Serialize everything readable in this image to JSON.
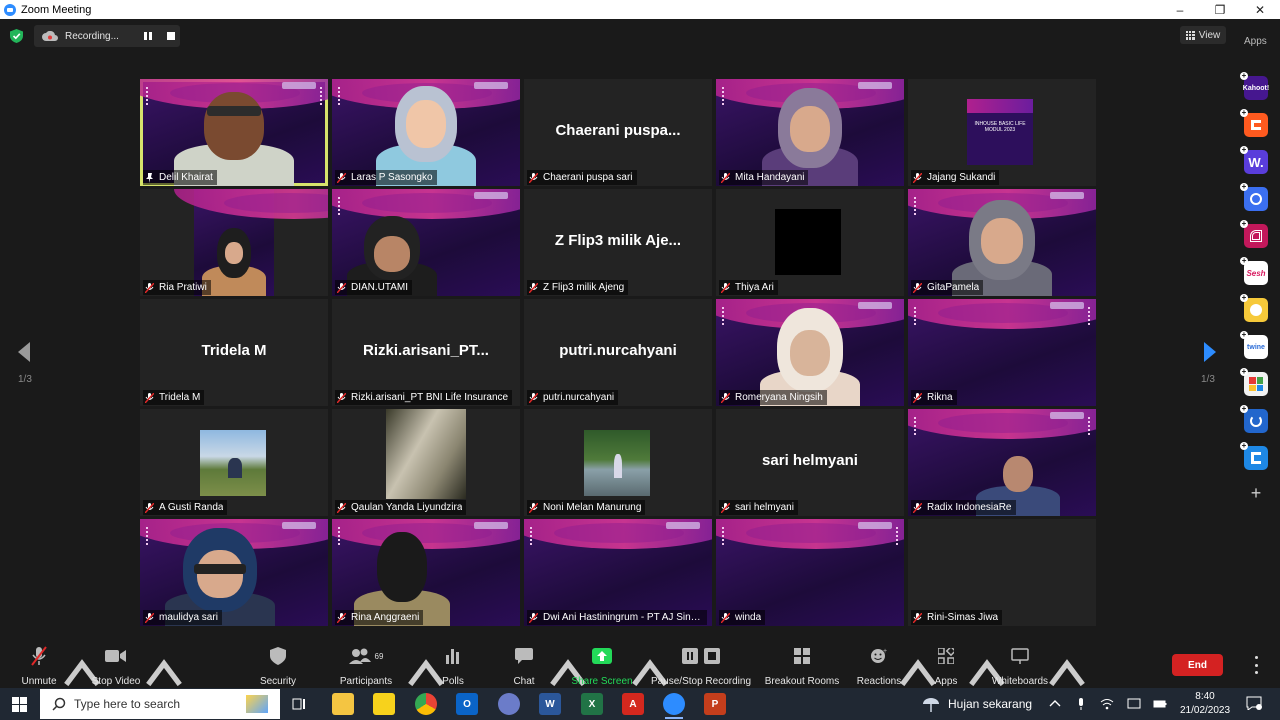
{
  "window": {
    "title": "Zoom Meeting",
    "controls": [
      "–",
      "❐",
      "✕"
    ]
  },
  "recording": {
    "label": "Recording..."
  },
  "view": {
    "label": "View"
  },
  "apps_label": "Apps",
  "pager": {
    "left": "1/3",
    "right": "1/3"
  },
  "participants": [
    {
      "name": "Delil Khairat",
      "pinned": true,
      "active": true
    },
    {
      "name": "Laras P Sasongko"
    },
    {
      "name": "Chaerani puspa sari",
      "display": "Chaerani  puspa..."
    },
    {
      "name": "Mita Handayani"
    },
    {
      "name": "Jajang Sukandi"
    },
    {
      "name": "Ria Pratiwi"
    },
    {
      "name": "DIAN.UTAMI"
    },
    {
      "name": "Z Flip3 milik Ajeng",
      "display": "Z Flip3 milik Aje..."
    },
    {
      "name": "Thiya Ari"
    },
    {
      "name": "GitaPamela"
    },
    {
      "name": "Tridela M",
      "display": "Tridela M"
    },
    {
      "name": "Rizki.arisani_PT BNI Life Insurance",
      "display": "Rizki.arisani_PT..."
    },
    {
      "name": "putri.nurcahyani",
      "display": "putri.nurcahyani"
    },
    {
      "name": "Romeryana Ningsih"
    },
    {
      "name": "Rikna"
    },
    {
      "name": "A Gusti Randa"
    },
    {
      "name": "Qaulan Yanda Liyundzira"
    },
    {
      "name": "Noni Melan Manurung"
    },
    {
      "name": "sari helmyani",
      "display": "sari helmyani"
    },
    {
      "name": "Radix IndonesiaRe"
    },
    {
      "name": "maulidya sari"
    },
    {
      "name": "Rina Anggraeni"
    },
    {
      "name": "Dwi Ani Hastiningrum - PT AJ Sina..."
    },
    {
      "name": "winda"
    },
    {
      "name": "Rini-Simas Jiwa"
    }
  ],
  "slide": {
    "title": "INHOUSE BASIC LIFE MODUL 2023"
  },
  "dock_apps": [
    {
      "icon": "kahoot-icon",
      "label": "Kahoot!",
      "color": "#46178f"
    },
    {
      "icon": "orange-app-icon",
      "label": "",
      "color": "#ff5a1f"
    },
    {
      "icon": "wooclap-icon",
      "label": "W.",
      "color": "#5a3ddb"
    },
    {
      "icon": "blue-circle-app-icon",
      "label": "",
      "color": "#3b6ff0"
    },
    {
      "icon": "pink-app-icon",
      "label": "",
      "color": "#c2185b"
    },
    {
      "icon": "sesh-icon",
      "label": "Sesh",
      "color": "#ffffff"
    },
    {
      "icon": "smile-app-icon",
      "label": "",
      "color": "#f6c93a"
    },
    {
      "icon": "twine-icon",
      "label": "twine",
      "color": "#ffffff"
    },
    {
      "icon": "grid-app-icon",
      "label": "",
      "color": "#f2f2f2"
    },
    {
      "icon": "sync-app-icon",
      "label": "",
      "color": "#2266cc"
    },
    {
      "icon": "blue-app-icon",
      "label": "",
      "color": "#1e88e5"
    }
  ],
  "toolbar": {
    "unmute": "Unmute",
    "stop_video": "Stop Video",
    "security": "Security",
    "participants": "Participants",
    "participants_count": "69",
    "polls": "Polls",
    "chat": "Chat",
    "share_screen": "Share Screen",
    "pause_stop": "Pause/Stop Recording",
    "breakout": "Breakout Rooms",
    "reactions": "Reactions",
    "apps": "Apps",
    "whiteboards": "Whiteboards",
    "end": "End"
  },
  "taskbar": {
    "search_placeholder": "Type here to search",
    "weather": "Hujan sekarang",
    "time": "8:40",
    "date": "21/02/2023"
  },
  "colors": {
    "accent_green": "#23d959",
    "end_red": "#d42222",
    "active_border": "#d7e36c"
  }
}
